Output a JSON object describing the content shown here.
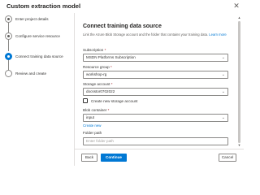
{
  "dialog": {
    "title": "Custom extraction model",
    "close_glyph": "✕"
  },
  "steps": [
    {
      "label": "Enter project details",
      "state": "done"
    },
    {
      "label": "Configure service resource",
      "state": "done"
    },
    {
      "label": "Connect training data source",
      "state": "current"
    },
    {
      "label": "Review and create",
      "state": "pending"
    }
  ],
  "main": {
    "heading": "Connect training data source",
    "description": "Link the Azure Blob Storage account and the folder that contains your training data.",
    "learn_more": "Learn more"
  },
  "fields": {
    "subscription": {
      "label": "Subscription",
      "required": "*",
      "value": "MSDN Platforms Subscription"
    },
    "resource_group": {
      "label": "Resource group",
      "required": "*",
      "value": "workshop-rg"
    },
    "storage_account": {
      "label": "Storage account",
      "required": "*",
      "value": "docsstor0702022"
    },
    "create_storage": {
      "label": "Create new storage account"
    },
    "blob_container": {
      "label": "Blob container",
      "required": "*",
      "value": "input"
    },
    "create_new_link": "Create new",
    "folder_path": {
      "label": "Folder path",
      "placeholder": "Enter folder path"
    }
  },
  "footer": {
    "back_label": "Back",
    "continue_label": "Continue",
    "cancel_label": "Cancel"
  },
  "icons": {
    "chevron": "⌄",
    "scroll_up": "▲",
    "scroll_down": "▼"
  },
  "colors": {
    "accent": "#0078d4",
    "required": "#a4262c"
  }
}
